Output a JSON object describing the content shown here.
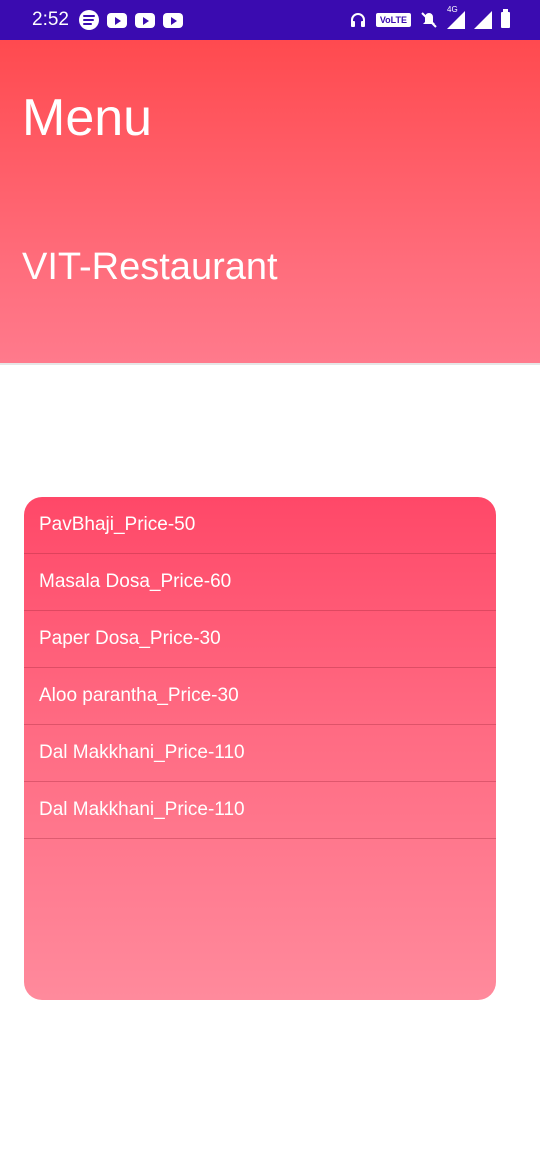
{
  "status_bar": {
    "time": "2:52",
    "network_label": "4G",
    "volte_label": "VoLTE"
  },
  "header": {
    "title": "Menu",
    "subtitle": "VIT-Restaurant"
  },
  "menu": {
    "items": [
      {
        "label": "PavBhaji_Price-50"
      },
      {
        "label": "Masala Dosa_Price-60"
      },
      {
        "label": "Paper Dosa_Price-30"
      },
      {
        "label": "Aloo parantha_Price-30"
      },
      {
        "label": "Dal Makkhani_Price-110"
      },
      {
        "label": "Dal Makkhani_Price-110"
      }
    ]
  },
  "colors": {
    "status_bar": "#3a0bb0",
    "header_top": "#ff4a4f",
    "header_bottom": "#ff7a8c",
    "card_top": "#ff4868",
    "card_bottom": "#ff8a9c"
  }
}
